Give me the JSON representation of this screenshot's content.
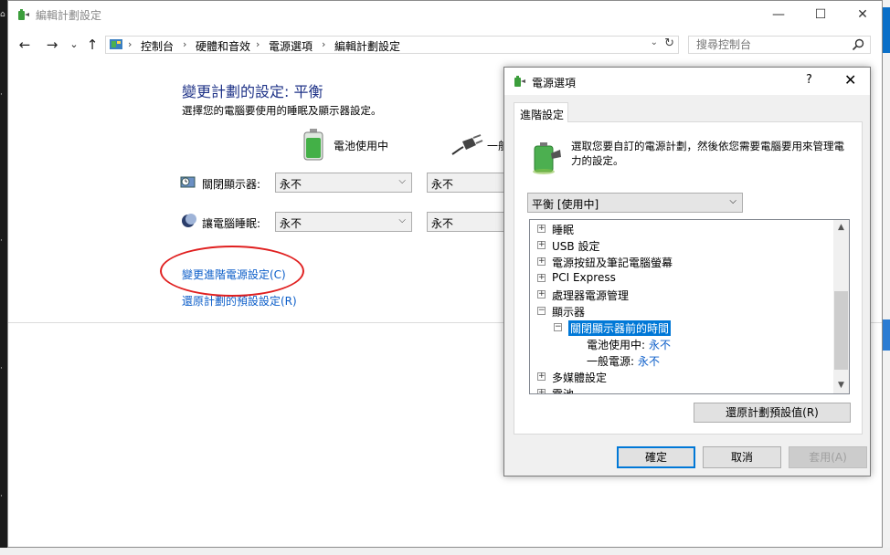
{
  "window": {
    "title": "編輯計劃設定",
    "minimize": "—",
    "maximize": "☐",
    "close": "✕"
  },
  "address": {
    "back": "←",
    "forward": "→",
    "recent": "⌄",
    "up": "↑",
    "breadcrumbs": [
      "控制台",
      "硬體和音效",
      "電源選項",
      "編輯計劃設定"
    ],
    "separator": "›",
    "search_placeholder": "搜尋控制台"
  },
  "page": {
    "title": "變更計劃的設定: 平衡",
    "subtitle": "選擇您的電腦要使用的睡眠及顯示器設定。",
    "battery_label": "電池使用中",
    "plugged_label": "一般",
    "display_label": "關閉顯示器:",
    "sleep_label": "讓電腦睡眠:",
    "display_battery": "永不",
    "display_plugged": "永不",
    "sleep_battery": "永不",
    "sleep_plugged": "永不",
    "advanced_link": "變更進階電源設定(C)",
    "restore_link": "還原計劃的預設設定(R)"
  },
  "dialog": {
    "title": "電源選項",
    "help": "?",
    "close": "✕",
    "tab": "進階設定",
    "description": "選取您要自訂的電源計劃，然後依您需要電腦要用來管理電力的設定。",
    "plan_selected": "平衡 [使用中]",
    "tree": [
      {
        "text": "睡眠",
        "expander": "+"
      },
      {
        "text": "USB 設定",
        "expander": "+"
      },
      {
        "text": "電源按鈕及筆記電腦螢幕",
        "expander": "+"
      },
      {
        "text": "PCI Express",
        "expander": "+"
      },
      {
        "text": "處理器電源管理",
        "expander": "+"
      },
      {
        "text": "顯示器",
        "expander": "−"
      },
      {
        "text": "關閉顯示器前的時間",
        "expander": "−"
      },
      {
        "text": "電池使用中:",
        "value": "永不"
      },
      {
        "text": "一般電源:",
        "value": "永不"
      },
      {
        "text": "多媒體設定",
        "expander": "+"
      },
      {
        "text": "電池",
        "expander": "+"
      }
    ],
    "restore_button": "還原計劃預設值(R)",
    "ok": "確定",
    "cancel": "取消",
    "apply": "套用(A)"
  },
  "colors": {
    "accent": "#0078d7",
    "title_blue": "#1e3287",
    "link_blue": "#0c5ec9",
    "highlight_red": "#e02020"
  },
  "icons": [
    "power-options-icon",
    "control-panel-icon",
    "search-icon",
    "battery-icon",
    "plug-icon",
    "monitor-icon",
    "moon-icon"
  ]
}
